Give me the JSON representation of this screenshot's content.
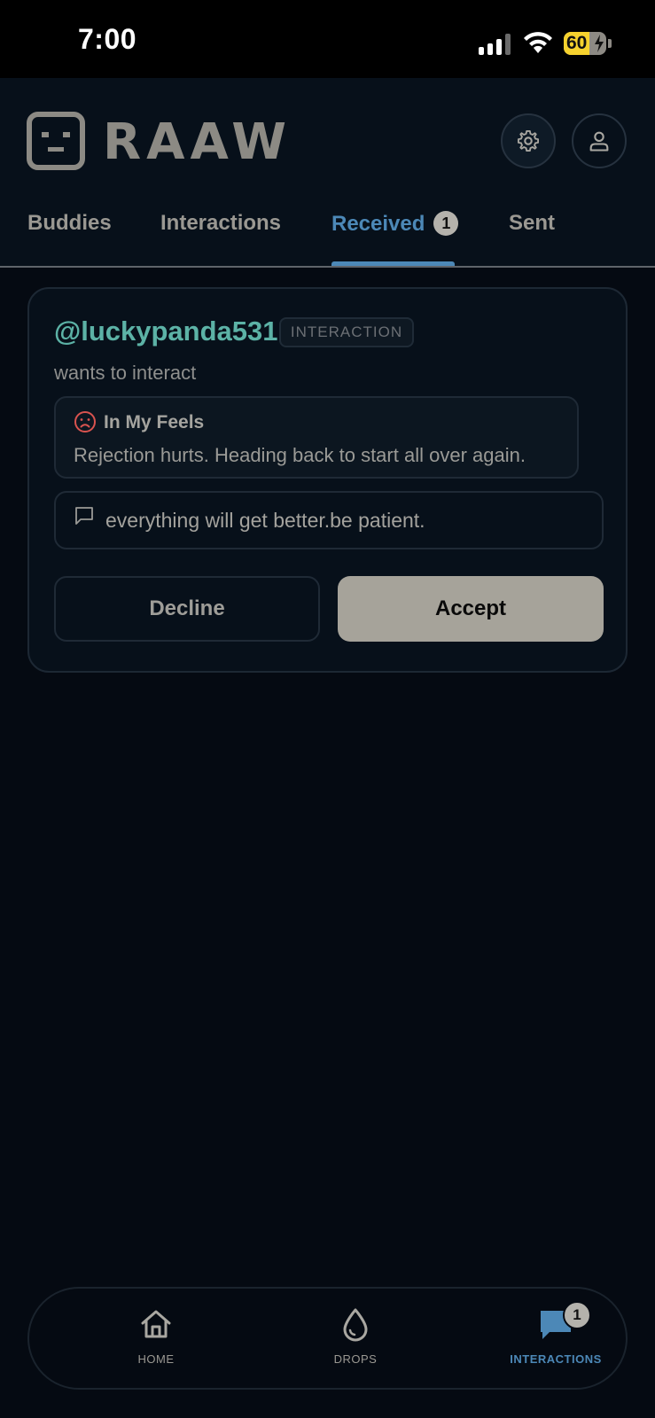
{
  "status_bar": {
    "time": "7:00",
    "battery": "60",
    "battery_level": 0.6
  },
  "header": {
    "app_name": "RAAW",
    "logo_icon": "robot-face-icon",
    "settings_icon": "gear-icon",
    "profile_icon": "user-icon"
  },
  "tabs": [
    {
      "label": "Buddies"
    },
    {
      "label": "Interactions"
    },
    {
      "label": "Received",
      "badge": "1",
      "active": true
    },
    {
      "label": "Sent"
    }
  ],
  "request": {
    "username": "@luckypanda531",
    "type": "INTERACTION",
    "subtitle": "wants to interact",
    "mood": {
      "icon": "sad-face-icon",
      "title": "In My Feels",
      "text": "Rejection hurts. Heading back to start all over again."
    },
    "comment": {
      "icon": "message-icon",
      "text": "everything will get better.be patient."
    },
    "decline_label": "Decline",
    "accept_label": "Accept"
  },
  "bottom_nav": [
    {
      "label": "HOME",
      "icon": "home-icon"
    },
    {
      "label": "DROPS",
      "icon": "droplet-icon"
    },
    {
      "label": "INTERACTIONS",
      "icon": "chat-bubble-icon",
      "badge": "1",
      "active": true
    }
  ],
  "colors": {
    "background": "#050a12",
    "accent": "#4c88b7",
    "username": "#5cb2a6",
    "accept_button": "#a6a39a"
  }
}
